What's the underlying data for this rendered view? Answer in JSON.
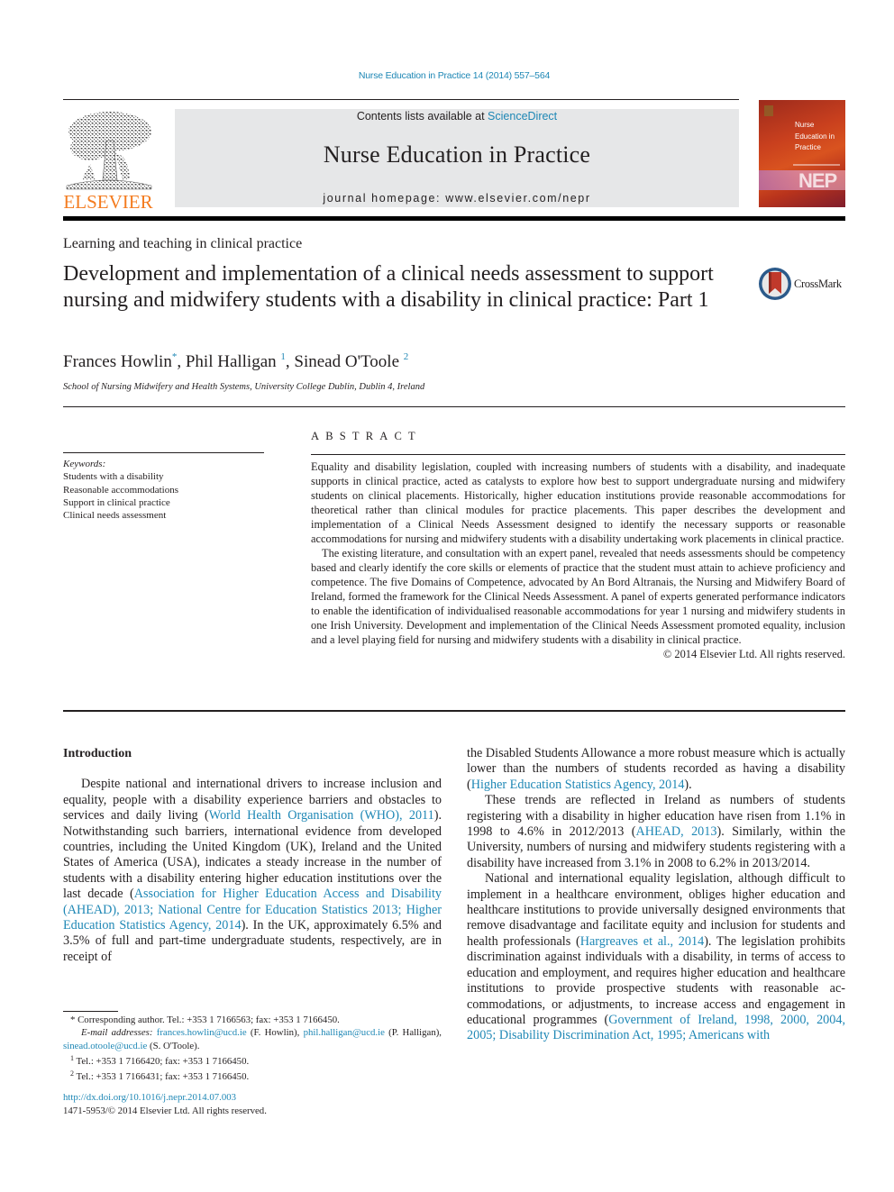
{
  "header": {
    "citation": "Nurse Education in Practice 14 (2014) 557–564",
    "contents_prefix": "Contents lists available at ",
    "contents_link": "ScienceDirect",
    "journal_title": "Nurse Education in Practice",
    "homepage": "journal homepage: www.elsevier.com/nepr",
    "publisher_logo_text": "ELSEVIER",
    "cover": {
      "title_line1": "Nurse",
      "title_line2": "Education in",
      "title_line3": "Practice",
      "abbrev": "NEP"
    },
    "colors": {
      "link": "#1e87b5",
      "elsevier_orange": "#f47c20",
      "masthead_bg": "#e6e7e8"
    }
  },
  "article": {
    "section": "Learning and teaching in clinical practice",
    "title": "Development and implementation of a clinical needs assessment to support nursing and midwifery students with a disability in clinical practice: Part 1",
    "crossmark_label": "CrossMark",
    "authors": [
      {
        "name": "Frances Howlin",
        "mark": "*",
        "sep": ", "
      },
      {
        "name": "Phil Halligan ",
        "mark": "1",
        "sep": ", "
      },
      {
        "name": "Sinead O'Toole ",
        "mark": "2",
        "sep": ""
      }
    ],
    "affiliation": "School of Nursing Midwifery and Health Systems, University College Dublin, Dublin 4, Ireland"
  },
  "keywords": {
    "heading": "Keywords:",
    "items": [
      "Students with a disability",
      "Reasonable accommodations",
      "Support in clinical practice",
      "Clinical needs assessment"
    ]
  },
  "abstract": {
    "heading": "ABSTRACT",
    "paragraphs": [
      "Equality and disability legislation, coupled with increasing numbers of students with a disability, and inadequate supports in clinical practice, acted as catalysts to explore how best to support undergraduate nursing and midwifery students on clinical placements. Historically, higher education institutions pro­vide reasonable accommodations for theoretical rather than clinical modules for practice placements. This paper describes the development and implementation of a Clinical Needs Assessment designed to identify the necessary supports or reasonable accommodations for nursing and midwifery students with a disability undertaking work placements in clinical practice.",
      "The existing literature, and consultation with an expert panel, revealed that needs assessments should be competency based and clearly identify the core skills or elements of practice that the student must attain to achieve proficiency and competence. The five Domains of Competence, advocated by An Bord Altranais, the Nursing and Midwifery Board of Ireland, formed the framework for the Clinical Needs Assessment. A panel of experts generated performance indicators to enable the identification of indi­vidualised reasonable accommodations for year 1 nursing and midwifery students in one Irish University. Development and implementation of the Clinical Needs Assessment promoted equality, inclusion and a level playing field for nursing and midwifery students with a disability in clinical practice."
    ],
    "copyright": "© 2014 Elsevier Ltd. All rights reserved."
  },
  "body": {
    "intro_heading": "Introduction",
    "left": {
      "p1_a": "Despite national and international drivers to increase inclusion and equality, people with a disability experience barriers and ob­stacles to services and daily living (",
      "p1_link1": "World Health Organisation (WHO), 2011",
      "p1_b": "). Notwithstanding such barriers, international evi­dence from developed countries, including the United Kingdom (UK), Ireland and the United States of America (USA), indicates a steady increase in the number of students with a disability entering higher education institutions over the last decade (",
      "p1_link2": "Association for Higher Education Access and Disability (AHEAD), 2013; National Centre for Education Statistics 2013; Higher Education Statistics Agency, 2014",
      "p1_c": "). In the UK, approximately 6.5% and 3.5% of full and part-time undergraduate students, respectively, are in receipt of"
    },
    "right": {
      "p1_a": "the Disabled Students Allowance a more robust measure which is actually lower than the numbers of students recorded as having a disability (",
      "p1_link": "Higher Education Statistics Agency, 2014",
      "p1_b": ").",
      "p2_a": "These trends are reflected in Ireland as numbers of students registering with a disability in higher education have risen from 1.1% in 1998 to 4.6% in 2012/2013 (",
      "p2_link": "AHEAD, 2013",
      "p2_b": "). Similarly, within the University, numbers of nursing and midwifery students regis­tering with a disability have increased from 3.1% in 2008 to 6.2% in 2013/2014.",
      "p3_a": "National and international equality legislation, although diffi­cult to implement in a healthcare environment, obliges higher education and healthcare institutions to provide universally designed environments that remove disadvantage and facilitate equity and inclusion for students and health professionals (",
      "p3_link1": "Hargreaves et al., 2014",
      "p3_b": "). The legislation prohibits discrimination against individuals with a disability, in terms of access to education and employment, and requires higher education and healthcare institutions to provide prospective students with reasonable ac­commodations, or adjustments, to increase access and engagement in educational programmes (",
      "p3_link2": "Government of Ireland, 1998, 2000, 2004, 2005; Disability Discrimination Act, 1995; Americans with"
    }
  },
  "footnotes": {
    "corresponding_mark": "*",
    "corresponding": "Corresponding author. Tel.: +353 1 7166563; fax: +353 1 7166450.",
    "email_label": "E-mail addresses:",
    "email1": "frances.howlin@ucd.ie",
    "email1_name": " (F. Howlin), ",
    "email2": "phil.halligan@ucd.ie",
    "email2_name": " (P. Halligan), ",
    "email3": "sinead.otoole@ucd.ie",
    "email3_name": " (S. O'Toole).",
    "fn1_mark": "1",
    "fn1": "Tel.: +353 1 7166420; fax: +353 1 7166450.",
    "fn2_mark": "2",
    "fn2": "Tel.: +353 1 7166431; fax: +353 1 7166450."
  },
  "doi": {
    "link": "http://dx.doi.org/10.1016/j.nepr.2014.07.003",
    "issn_copyright": "1471-5953/© 2014 Elsevier Ltd. All rights reserved."
  }
}
